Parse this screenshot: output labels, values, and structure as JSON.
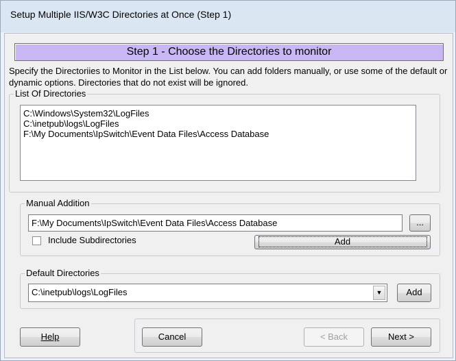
{
  "window": {
    "title": "Setup Multiple IIS/W3C Directories at Once (Step 1)"
  },
  "banner": "Step 1 - Choose the Directories to monitor",
  "description": "Specify the Directoriies to Monitor in the List below. You can add folders manually, or use some of the default or dynamic options. Directories that do not exist will be ignored.",
  "list_section": {
    "legend": "List Of Directories",
    "items": [
      "C:\\Windows\\System32\\LogFiles",
      "C:\\inetpub\\logs\\LogFiles",
      "F:\\My Documents\\IpSwitch\\Event Data Files\\Access Database"
    ]
  },
  "manual_section": {
    "legend": "Manual Addition",
    "path_value": "F:\\My Documents\\IpSwitch\\Event Data Files\\Access Database",
    "browse_label": "...",
    "include_subdirs_label": "Include Subdirectories",
    "include_subdirs_checked": false,
    "add_label": "Add"
  },
  "default_section": {
    "legend": "Default Directories",
    "selected": "C:\\inetpub\\logs\\LogFiles",
    "add_label": "Add"
  },
  "footer": {
    "help_label": "Help",
    "cancel_label": "Cancel",
    "back_label": "< Back",
    "next_label": "Next >"
  }
}
